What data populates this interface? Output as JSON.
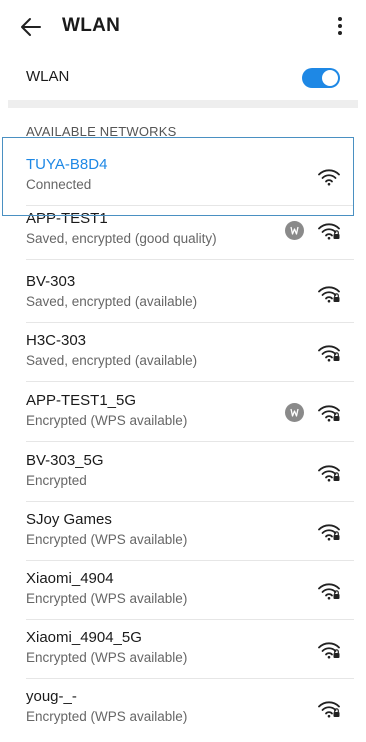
{
  "header": {
    "title": "WLAN",
    "back_icon": "back-arrow-icon",
    "more_icon": "more-vertical-icon"
  },
  "wlan_toggle": {
    "label": "WLAN",
    "state": "on",
    "accent": "#1e88e5"
  },
  "section_title": "AVAILABLE NETWORKS",
  "networks": [
    {
      "name": "TUYA-B8D4",
      "status": "Connected",
      "locked": false,
      "wps": false,
      "connected": true
    },
    {
      "name": "APP-TEST1",
      "status": "Saved, encrypted (good quality)",
      "locked": true,
      "wps": true,
      "connected": false
    },
    {
      "name": "BV-303",
      "status": "Saved, encrypted (available)",
      "locked": true,
      "wps": false,
      "connected": false
    },
    {
      "name": "H3C-303",
      "status": "Saved, encrypted (available)",
      "locked": true,
      "wps": false,
      "connected": false
    },
    {
      "name": "APP-TEST1_5G",
      "status": "Encrypted (WPS available)",
      "locked": true,
      "wps": true,
      "connected": false
    },
    {
      "name": "BV-303_5G",
      "status": "Encrypted",
      "locked": true,
      "wps": false,
      "connected": false
    },
    {
      "name": "SJoy Games",
      "status": "Encrypted (WPS available)",
      "locked": true,
      "wps": false,
      "connected": false
    },
    {
      "name": "Xiaomi_4904",
      "status": "Encrypted (WPS available)",
      "locked": true,
      "wps": false,
      "connected": false
    },
    {
      "name": "Xiaomi_4904_5G",
      "status": "Encrypted (WPS available)",
      "locked": true,
      "wps": false,
      "connected": false
    },
    {
      "name": "youg-_-",
      "status": "Encrypted (WPS available)",
      "locked": true,
      "wps": false,
      "connected": false
    }
  ]
}
